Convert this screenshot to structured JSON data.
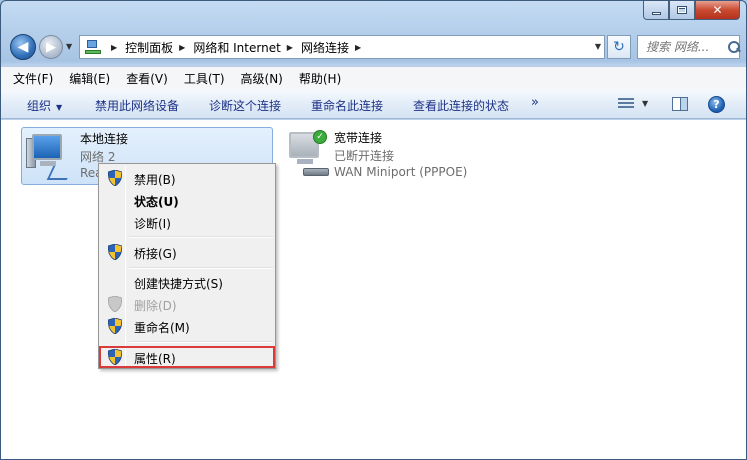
{
  "window": {
    "caption": {
      "close_glyph": "✕"
    }
  },
  "nav": {
    "back_glyph": "◀",
    "forward_glyph": "▶",
    "breadcrumbs": [
      "控制面板",
      "网络和 Internet",
      "网络连接"
    ],
    "refresh_glyph": "↻",
    "search_placeholder": "搜索 网络..."
  },
  "menubar": {
    "items": [
      "文件(F)",
      "编辑(E)",
      "查看(V)",
      "工具(T)",
      "高级(N)",
      "帮助(H)"
    ]
  },
  "commandbar": {
    "organize": "组织",
    "disable": "禁用此网络设备",
    "diagnose": "诊断这个连接",
    "rename": "重命名此连接",
    "view_status": "查看此连接的状态",
    "more": "»",
    "help": "?"
  },
  "connections": [
    {
      "name": "本地连接",
      "network": "网络  2",
      "device": "Rea"
    },
    {
      "name": "宽带连接",
      "status": "已断开连接",
      "device": "WAN Miniport (PPPOE)"
    }
  ],
  "context_menu": {
    "items": [
      {
        "label": "禁用(B)",
        "shield": true
      },
      {
        "label": "状态(U)",
        "bold": true
      },
      {
        "label": "诊断(I)"
      },
      {
        "label": "桥接(G)",
        "shield": true
      },
      {
        "label": "创建快捷方式(S)"
      },
      {
        "label": "删除(D)",
        "disabled": true,
        "shield": true
      },
      {
        "label": "重命名(M)",
        "shield": true
      },
      {
        "label": "属性(R)",
        "shield": true,
        "highlighted": true
      }
    ]
  },
  "colors": {
    "highlight_border": "#d93a3a",
    "command_text": "#1e3287"
  }
}
